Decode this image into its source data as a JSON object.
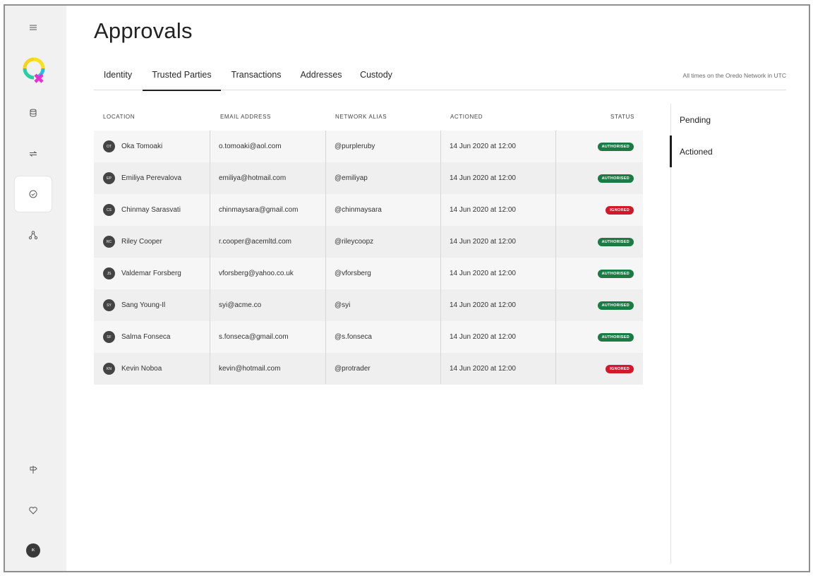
{
  "page": {
    "title": "Approvals",
    "tz_note": "All times on the Oredo Network in UTC"
  },
  "tabs": [
    {
      "label": "Identity"
    },
    {
      "label": "Trusted Parties"
    },
    {
      "label": "Transactions"
    },
    {
      "label": "Addresses"
    },
    {
      "label": "Custody"
    }
  ],
  "active_tab": "Trusted Parties",
  "filters": [
    {
      "label": "Pending"
    },
    {
      "label": "Actioned"
    }
  ],
  "active_filter": "Actioned",
  "table": {
    "headers": {
      "location": "LOCATION",
      "email": "EMAIL ADDRESS",
      "alias": "NETWORK ALIAS",
      "actioned": "ACTIONED",
      "status": "STATUS"
    },
    "rows": [
      {
        "initials": "OT",
        "name": "Oka Tomoaki",
        "email": "o.tomoaki@aol.com",
        "alias": "@purpleruby",
        "actioned": "14 Jun 2020 at 12:00",
        "status": "AUTHORISED"
      },
      {
        "initials": "EP",
        "name": "Emiliya Perevalova",
        "email": "emiliya@hotmail.com",
        "alias": "@emiliyap",
        "actioned": "14 Jun 2020 at 12:00",
        "status": "AUTHORISED"
      },
      {
        "initials": "CS",
        "name": "Chinmay Sarasvati",
        "email": "chinmaysara@gmail.com",
        "alias": "@chinmaysara",
        "actioned": "14 Jun 2020 at 12:00",
        "status": "IGNORED"
      },
      {
        "initials": "RC",
        "name": "Riley Cooper",
        "email": "r.cooper@acemltd.com",
        "alias": "@rileycoopz",
        "actioned": "14 Jun 2020 at 12:00",
        "status": "AUTHORISED"
      },
      {
        "initials": "JS",
        "name": "Valdemar Forsberg",
        "email": "vforsberg@yahoo.co.uk",
        "alias": "@vforsberg",
        "actioned": "14 Jun 2020 at 12:00",
        "status": "AUTHORISED"
      },
      {
        "initials": "SY",
        "name": "Sang Young-Il",
        "email": "syi@acme.co",
        "alias": "@syi",
        "actioned": "14 Jun 2020 at 12:00",
        "status": "AUTHORISED"
      },
      {
        "initials": "SF",
        "name": "Salma Fonseca",
        "email": "s.fonseca@gmail.com",
        "alias": "@s.fonseca",
        "actioned": "14 Jun 2020 at 12:00",
        "status": "AUTHORISED"
      },
      {
        "initials": "KN",
        "name": "Kevin Noboa",
        "email": "kevin@hotmail.com",
        "alias": "@protrader",
        "actioned": "14 Jun 2020 at 12:00",
        "status": "IGNORED"
      }
    ]
  },
  "user": {
    "initials": "IK"
  },
  "colors": {
    "authorised": "#1c7a45",
    "ignored": "#d3182b",
    "sidebar": "#f1f1f1"
  },
  "icons": {
    "sidebar_top": [
      "menu-icon",
      "logo",
      "database-icon",
      "transfer-icon",
      "check-circle-icon",
      "network-icon"
    ],
    "sidebar_bottom": [
      "signpost-icon",
      "heart-icon",
      "user-avatar"
    ]
  }
}
